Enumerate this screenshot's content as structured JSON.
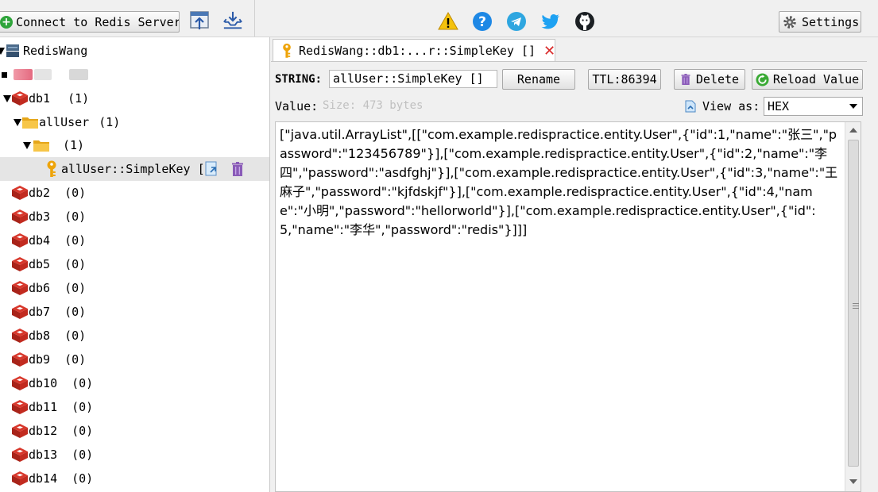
{
  "toolbar": {
    "connect_label": "Connect to Redis Server",
    "settings_label": "Settings"
  },
  "icons": {
    "import": "import-icon",
    "export": "export-icon",
    "warning": "warning-icon",
    "help": "help-icon",
    "telegram": "telegram-icon",
    "twitter": "twitter-icon",
    "github": "github-icon"
  },
  "colors": {
    "redis_red": "#c6302b",
    "folder": "#f5b82a",
    "key": "#e6a100",
    "trash": "#8a5bb8",
    "help_blue": "#1e88e5",
    "telegram_blue": "#2ea6e0",
    "twitter_blue": "#1da1f2",
    "reload_green": "#3aaa35"
  },
  "tree": {
    "server": "RedisWang",
    "db1": {
      "label": "db1",
      "count": "(1)"
    },
    "folder": {
      "label": "allUser",
      "count": "(1)"
    },
    "subfolder": {
      "count": "(1)"
    },
    "key": {
      "label": "allUser::SimpleKey ["
    },
    "dbs": [
      {
        "label": "db2",
        "count": "(0)"
      },
      {
        "label": "db3",
        "count": "(0)"
      },
      {
        "label": "db4",
        "count": "(0)"
      },
      {
        "label": "db5",
        "count": "(0)"
      },
      {
        "label": "db6",
        "count": "(0)"
      },
      {
        "label": "db7",
        "count": "(0)"
      },
      {
        "label": "db8",
        "count": "(0)"
      },
      {
        "label": "db9",
        "count": "(0)"
      },
      {
        "label": "db10",
        "count": "(0)"
      },
      {
        "label": "db11",
        "count": "(0)"
      },
      {
        "label": "db12",
        "count": "(0)"
      },
      {
        "label": "db13",
        "count": "(0)"
      },
      {
        "label": "db14",
        "count": "(0)"
      }
    ]
  },
  "tab": {
    "title": "RedisWang::db1:...r::SimpleKey []"
  },
  "key_editor": {
    "type_label": "STRING:",
    "key_name": "allUser::SimpleKey []",
    "rename_label": "Rename",
    "ttl_label": "TTL:86394",
    "delete_label": "Delete",
    "reload_label": "Reload Value",
    "value_label": "Value:",
    "size_label": "Size: 473 bytes",
    "view_as_label": "View as:",
    "view_as_value": "HEX",
    "value_text": "[\"java.util.ArrayList\",[[\"com.example.redispractice.entity.User\",{\"id\":1,\"name\":\"张三\",\"password\":\"123456789\"}],[\"com.example.redispractice.entity.User\",{\"id\":2,\"name\":\"李四\",\"password\":\"asdfghj\"}],[\"com.example.redispractice.entity.User\",{\"id\":3,\"name\":\"王麻子\",\"password\":\"kjfdskjf\"}],[\"com.example.redispractice.entity.User\",{\"id\":4,\"name\":\"小明\",\"password\":\"hellorworld\"}],[\"com.example.redispractice.entity.User\",{\"id\":5,\"name\":\"李华\",\"password\":\"redis\"}]]]"
  }
}
